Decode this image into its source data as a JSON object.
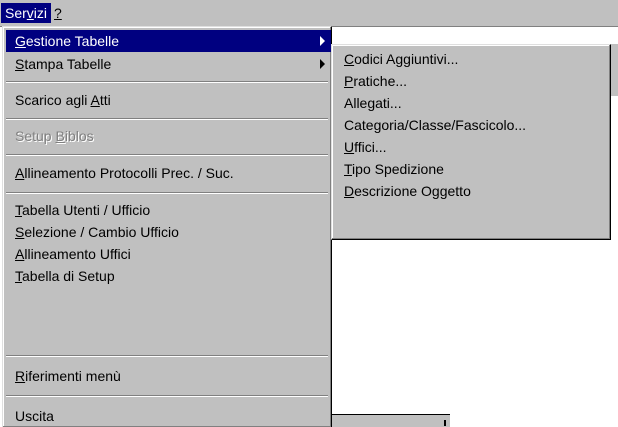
{
  "menubar": {
    "servizi": {
      "pre": "Ser",
      "acc": "v",
      "post": "izi"
    },
    "help": {
      "pre": "",
      "acc": "?",
      "post": ""
    }
  },
  "main_menu": {
    "items": [
      {
        "pre": "",
        "acc": "G",
        "post": "estione Tabelle",
        "submenu": true
      },
      {
        "pre": "",
        "acc": "S",
        "post": "tampa Tabelle",
        "submenu": true
      },
      {
        "pre": "Scarico agli ",
        "acc": "A",
        "post": "tti"
      },
      {
        "pre": "Setup ",
        "acc": "B",
        "post": "iblos"
      },
      {
        "pre": "",
        "acc": "A",
        "post": "llineamento Protocolli Prec. / Suc."
      },
      {
        "pre": "",
        "acc": "T",
        "post": "abella Utenti / Ufficio"
      },
      {
        "pre": "",
        "acc": "S",
        "post": "elezione / Cambio Ufficio"
      },
      {
        "pre": "",
        "acc": "A",
        "post": "llineamento Uffici"
      },
      {
        "pre": "",
        "acc": "T",
        "post": "abella di Setup"
      },
      {
        "pre": "",
        "acc": "R",
        "post": "iferimenti menù"
      },
      {
        "pre": "Uscita",
        "acc": "",
        "post": ""
      }
    ]
  },
  "sub_menu": {
    "items": [
      {
        "pre": "",
        "acc": "C",
        "post": "odici Aggiuntivi..."
      },
      {
        "pre": "",
        "acc": "P",
        "post": "ratiche..."
      },
      {
        "pre": "Allegati...",
        "acc": "",
        "post": ""
      },
      {
        "pre": "Categoria/Classe/Fascicolo...",
        "acc": "",
        "post": ""
      },
      {
        "pre": "",
        "acc": "U",
        "post": "ffici..."
      },
      {
        "pre": "",
        "acc": "T",
        "post": "ipo Spedizione"
      },
      {
        "pre": "",
        "acc": "D",
        "post": "escrizione Oggetto"
      }
    ]
  },
  "colors": {
    "menu_face": "#c0c0c0",
    "highlight": "#000080",
    "disabled_text": "#808080"
  }
}
